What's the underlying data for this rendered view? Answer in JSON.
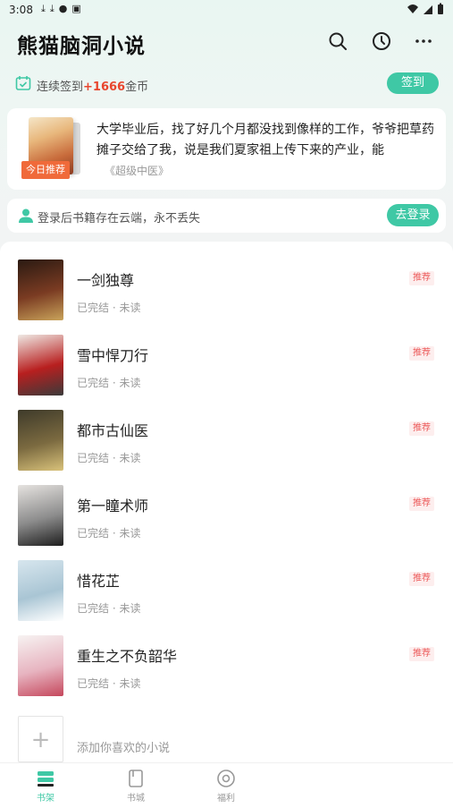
{
  "status_bar": {
    "time": "3:08"
  },
  "header": {
    "app_title": "熊猫脑洞小说"
  },
  "checkin": {
    "prefix": "连续签到",
    "reward": "+1666",
    "suffix": "金币",
    "button_label": "签到"
  },
  "recommend": {
    "badge": "今日推荐",
    "description": "大学毕业后，找了好几个月都没找到像样的工作，爷爷把草药摊子交给了我，说是我们夏家祖上传下来的产业，能",
    "source": "《超级中医》"
  },
  "login": {
    "text": "登录后书籍存在云端，永不丢失",
    "button_label": "去登录"
  },
  "books": [
    {
      "title": "一剑独尊",
      "status": "已完结 · 未读",
      "tag": "推荐",
      "cover_colors": [
        "#2a1a12",
        "#7a3b22",
        "#c9a35a"
      ]
    },
    {
      "title": "雪中悍刀行",
      "status": "已完结 · 未读",
      "tag": "推荐",
      "cover_colors": [
        "#efe9e4",
        "#b81f1f",
        "#3a3a3a"
      ]
    },
    {
      "title": "都市古仙医",
      "status": "已完结 · 未读",
      "tag": "推荐",
      "cover_colors": [
        "#3e3a2a",
        "#7b6a40",
        "#d9c27a"
      ]
    },
    {
      "title": "第一瞳术师",
      "status": "已完结 · 未读",
      "tag": "推荐",
      "cover_colors": [
        "#e6e3e0",
        "#8c8c8c",
        "#1e1e1e"
      ]
    },
    {
      "title": "惜花芷",
      "status": "已完结 · 未读",
      "tag": "推荐",
      "cover_colors": [
        "#d7e6ee",
        "#a9c5d4",
        "#ffffff"
      ]
    },
    {
      "title": "重生之不负韶华",
      "status": "已完结 · 未读",
      "tag": "推荐",
      "cover_colors": [
        "#f7f3f2",
        "#e7b4c0",
        "#c5475c"
      ]
    }
  ],
  "add_book": {
    "text": "添加你喜欢的小说"
  },
  "bottom_nav": [
    {
      "label": "书架",
      "icon": "bookshelf-icon",
      "active": true
    },
    {
      "label": "书城",
      "icon": "book-store-icon",
      "active": false
    },
    {
      "label": "福利",
      "icon": "welfare-icon",
      "active": false
    }
  ],
  "colors": {
    "accent": "#3fc8a5",
    "reward": "#e8462e",
    "tag": "#ec5a5a"
  }
}
